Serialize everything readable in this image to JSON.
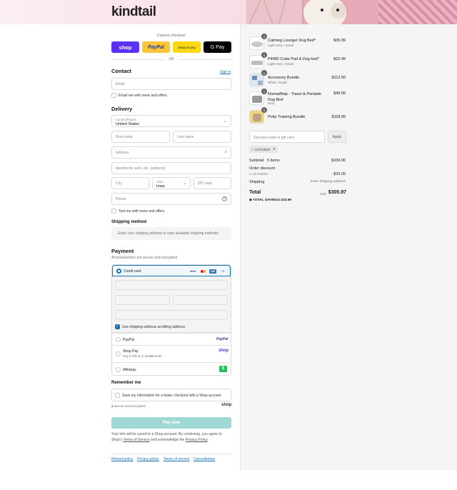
{
  "header": {
    "logo": "kindtail"
  },
  "express": {
    "label": "Express checkout",
    "buttons": [
      {
        "label": "shop",
        "color": "#5a31f4"
      },
      {
        "label": "PayPal",
        "color": "#ffc439"
      },
      {
        "label": "amazon pay",
        "color": "#ffd814"
      },
      {
        "label": "G Pay",
        "color": "#000000"
      }
    ],
    "or": "OR"
  },
  "contact": {
    "title": "Contact",
    "signin": "Sign in",
    "email_placeholder": "Email",
    "news_label": "Email me with news and offers"
  },
  "delivery": {
    "title": "Delivery",
    "country_label": "Country/Region",
    "country_value": "United States",
    "first_name": "First name",
    "last_name": "Last name",
    "address": "Address",
    "apartment": "Apartment, suite, etc. (optional)",
    "city": "City",
    "state_label": "State",
    "state_value": "Iowa",
    "zip": "ZIP code",
    "phone": "Phone",
    "text_label": "Text me with news and offers"
  },
  "shipping": {
    "title": "Shipping method",
    "message": "Enter your shipping address to view available shipping methods."
  },
  "payment": {
    "title": "Payment",
    "subtitle": "All transactions are secure and encrypted.",
    "credit_card": "Credit card",
    "more_cards": "+3",
    "billing_label": "Use shipping address as billing address",
    "paypal": "PayPal",
    "shoppay": "Shop Pay",
    "shoppay_sub": "Pay in full or in installments",
    "shop_logo": "shop",
    "afterpay": "Afterpay"
  },
  "remember": {
    "title": "Remember me",
    "label": "Save my information for a faster checkout with a Shop account",
    "secure": "Secure and encrypted",
    "shop": "shop"
  },
  "paynow": "Pay now",
  "legal": {
    "line1": "Your info will be saved to a Shop account. By continuing, you agree to",
    "line2a": "Shop's ",
    "terms": "Terms of Service",
    "line2b": " and acknowledge the ",
    "privacy": "Privacy Policy",
    "line2c": "."
  },
  "footer_links": [
    "Refund policy",
    "Privacy policy",
    "Terms of service",
    "Cancellations"
  ],
  "order": {
    "items": [
      {
        "qty": "1",
        "name": "Calming Lounger Dog Bed*",
        "variant": "Light Grey / Small",
        "price": "$35.99"
      },
      {
        "qty": "1",
        "name": "P4WD Crate Pad & Dog bed*",
        "variant": "Light Grey / Small",
        "price": "$22.49"
      },
      {
        "qty": "1",
        "name": "Accessory Bundle",
        "variant": "White / Small",
        "price": "$112.50"
      },
      {
        "qty": "1",
        "name": "NomadNap - Travel & Portable Dog Bed",
        "variant": "Grey",
        "price": "$49.99"
      },
      {
        "qty": "1",
        "name": "Potty Training Bundle",
        "variant": "",
        "price": "$118.99"
      }
    ],
    "discount_placeholder": "Discount code or gift card",
    "apply": "Apply",
    "code": "ACTIVE10",
    "subtotal_label": "Subtotal · 5 items",
    "subtotal": "$339.96",
    "order_discount": "Order discount",
    "discount_code": "ACTIVE10",
    "discount_amount": "- $33.99",
    "shipping_label": "Shipping",
    "shipping_value": "Enter shipping address",
    "total_label": "Total",
    "currency": "USD",
    "total": "$305.97",
    "savings_label": "TOTAL SAVINGS",
    "savings": "$33.99"
  }
}
